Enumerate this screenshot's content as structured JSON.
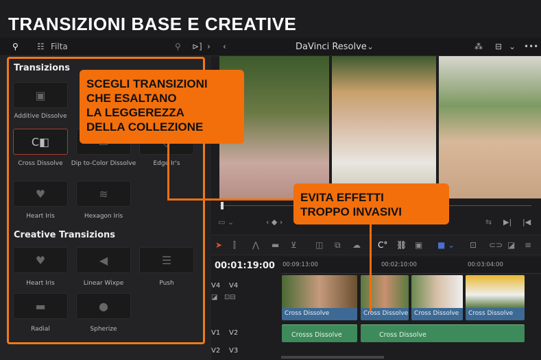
{
  "title": "TRANSIZIONI BASE E CREATIVE",
  "topbar": {
    "filter_label": "Filta",
    "app_title": "DaVinci Resolve"
  },
  "panel": {
    "section1": "Transizions",
    "items1": [
      {
        "label": "Additive Dissolve",
        "icon": "additive-dissolve-icon"
      },
      {
        "label": "Cross Dissolve",
        "icon": "cross-dissolve-icon",
        "selected": true
      },
      {
        "label": "Dip to-Color Dissolve",
        "icon": "dip-to-color-icon"
      },
      {
        "label": "Edge Ir's",
        "icon": "edge-iris-icon"
      },
      {
        "label": "Heart Iris",
        "icon": "heart-icon"
      },
      {
        "label": "Hexagon Iris",
        "icon": "hexagon-iris-icon"
      }
    ],
    "section2": "Creative Transizions",
    "items2": [
      {
        "label": "Heart Iris",
        "icon": "heart-icon"
      },
      {
        "label": "Linear Wiхpe",
        "icon": "linear-wipe-icon"
      },
      {
        "label": "Push",
        "icon": "push-icon"
      },
      {
        "label": "Radial",
        "icon": "radial-icon"
      },
      {
        "label": "Spherize",
        "icon": "spherize-icon"
      }
    ]
  },
  "callouts": {
    "c1": [
      "SCEGLI TRANSIZIONI",
      "CHE ESALTANO",
      "LA LEGGEREZZA",
      "DELLA COLLEZIONE"
    ],
    "c2": [
      "EVITA EFFETTI",
      "TROPPO INVASIVI"
    ]
  },
  "timeline": {
    "timecode": "00:01:19:00",
    "ruler": [
      "00:09:13:00",
      "00:02:10:00",
      "00:03:04:00"
    ],
    "tracks": [
      {
        "a": "V4",
        "b": "V4"
      },
      {
        "a": "V1",
        "b": "V2"
      },
      {
        "a": "V2",
        "b": "V3"
      }
    ],
    "clips": [
      "Cross Dissolve",
      "Cross Dissolve",
      "Cross Dissolve",
      "Cross Dissolve"
    ],
    "green_clips": [
      "Crosss Dissolve",
      "Cross Dissolve"
    ]
  },
  "colors": {
    "accent": "#f36f0c",
    "clip_blue": "#3d6a94",
    "clip_green": "#3d8a5a"
  }
}
